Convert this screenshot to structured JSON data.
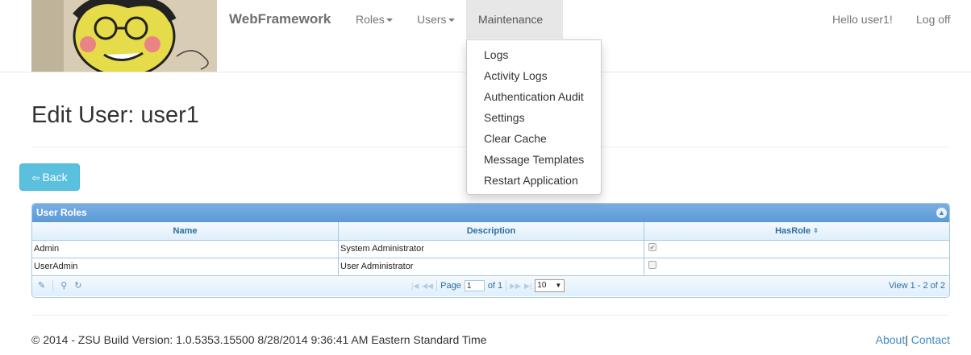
{
  "navbar": {
    "brand": "WebFramework",
    "menus": [
      {
        "label": "Roles"
      },
      {
        "label": "Users"
      },
      {
        "label": "Maintenance"
      }
    ],
    "greeting": "Hello user1!",
    "logoff": "Log off"
  },
  "dropdown": {
    "items": [
      "Logs",
      "Activity Logs",
      "Authentication Audit",
      "Settings",
      "Clear Cache",
      "Message Templates",
      "Restart Application"
    ]
  },
  "page": {
    "title": "Edit User: user1",
    "back_label": "Back"
  },
  "grid": {
    "caption": "User Roles",
    "columns": [
      "Name",
      "Description",
      "HasRole"
    ],
    "rows": [
      {
        "name": "Admin",
        "description": "System Administrator",
        "has_role": true
      },
      {
        "name": "UserAdmin",
        "description": "User Administrator",
        "has_role": false
      }
    ],
    "pager": {
      "page_label": "Page",
      "page_value": "1",
      "of_label": "of 1",
      "rows_per_page": "10",
      "view_text": "View 1 - 2 of 2"
    }
  },
  "footer": {
    "text": "© 2014 - ZSU Build Version: 1.0.5353.15500 8/28/2014 9:36:41 AM Eastern Standard Time",
    "about": "About",
    "separator": "|",
    "contact": "Contact"
  },
  "colors": {
    "info_button": "#5bc0de",
    "grid_header": "#5c9ad6",
    "link": "#428bca"
  }
}
